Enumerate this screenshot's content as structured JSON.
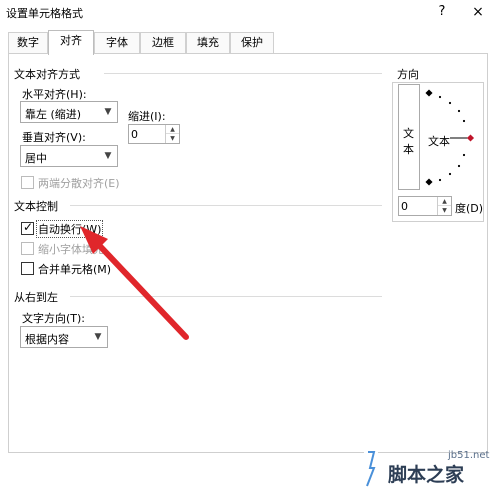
{
  "dialog": {
    "title": "设置单元格格式",
    "help": "?",
    "close": "×"
  },
  "tabs": [
    {
      "label": "数字"
    },
    {
      "label": "对齐"
    },
    {
      "label": "字体"
    },
    {
      "label": "边框"
    },
    {
      "label": "填充"
    },
    {
      "label": "保护"
    }
  ],
  "alignment": {
    "section": "文本对齐方式",
    "horizontal_label": "水平对齐(H):",
    "horizontal_value": "靠左 (缩进)",
    "indent_label": "缩进(I):",
    "indent_value": "0",
    "vertical_label": "垂直对齐(V):",
    "vertical_value": "居中",
    "distributed_label": "两端分散对齐(E)"
  },
  "text_control": {
    "section": "文本控制",
    "wrap_label": "自动换行(W)",
    "wrap_checked": true,
    "shrink_label": "缩小字体填充",
    "merge_label": "合并单元格(M)"
  },
  "rtl": {
    "section": "从右到左",
    "direction_label": "文字方向(T):",
    "direction_value": "根据内容"
  },
  "orientation": {
    "section": "方向",
    "vertical_text": "文本",
    "dial_text": "文本",
    "degree_value": "0",
    "degree_label": "度(D)"
  },
  "watermark": {
    "url": "jb51.net",
    "text": "脚本之家"
  },
  "colors": {
    "arrow": "#e0262b",
    "dial_marker": "#c0142a"
  }
}
